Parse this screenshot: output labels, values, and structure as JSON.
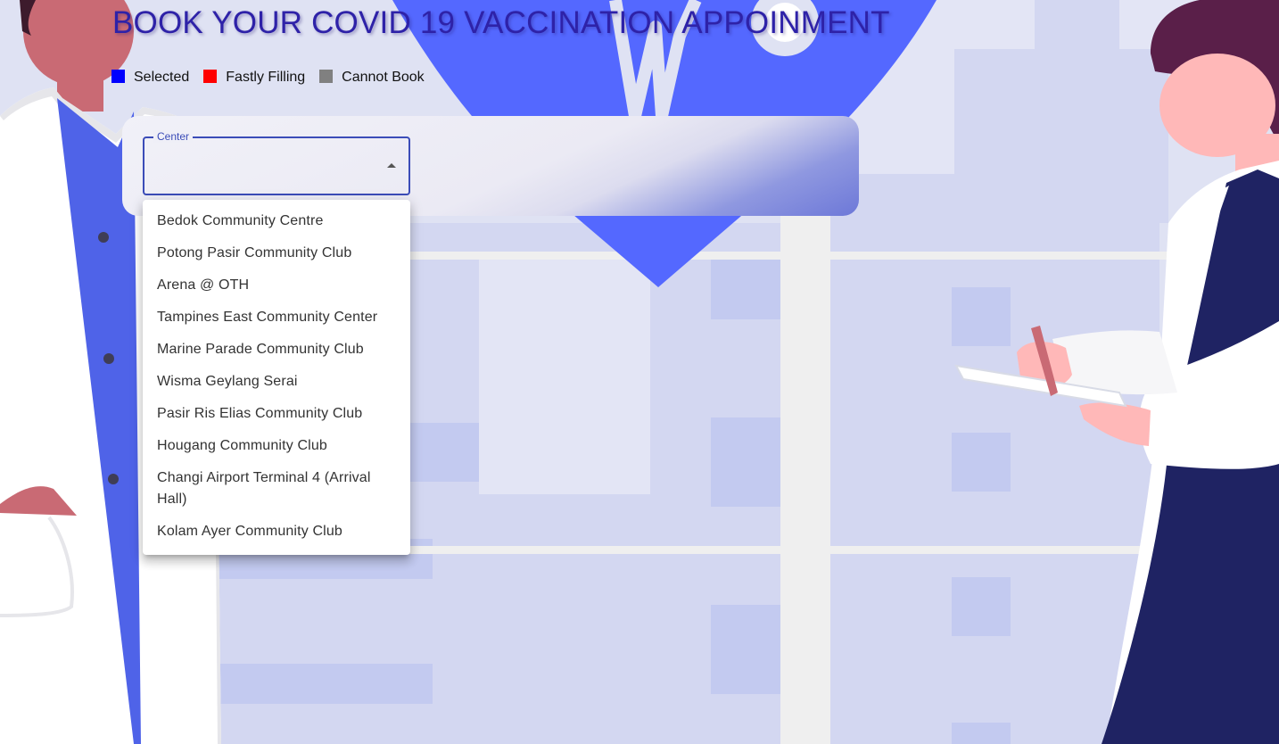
{
  "header": {
    "title": "BOOK YOUR COVID 19 VACCINATION APPOINMENT"
  },
  "legend": [
    {
      "label": "Selected",
      "color": "#0000ff"
    },
    {
      "label": "Fastly Filling",
      "color": "#ff0000"
    },
    {
      "label": "Cannot Book",
      "color": "#808080"
    }
  ],
  "center_select": {
    "label": "Center",
    "value": "",
    "expanded": true,
    "options": [
      "Bedok Community Centre",
      "Potong Pasir Community Club",
      "Arena @ OTH",
      "Tampines East Community Center",
      "Marine Parade Community Club",
      "Wisma Geylang Serai",
      "Pasir Ris Elias Community Club",
      "Hougang Community Club",
      "Changi Airport Terminal 4 (Arrival Hall)",
      "Kolam Ayer Community Club"
    ]
  },
  "theme": {
    "title_color": "#2e22a8",
    "accent": "#3b4cb8",
    "heart_color": "#5468ff"
  }
}
